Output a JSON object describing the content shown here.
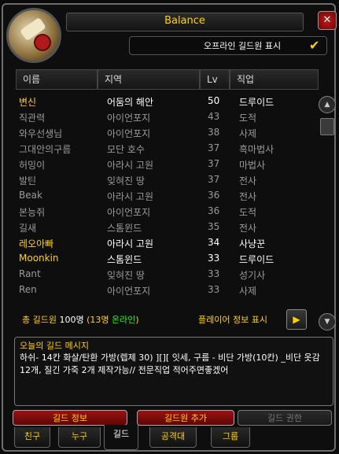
{
  "window": {
    "title": "Balance",
    "close_symbol": "✕"
  },
  "offline": {
    "label": "오프라인 길드원 표시",
    "checked": true,
    "check_symbol": "✔"
  },
  "columns": [
    "이름",
    "지역",
    "Lv",
    "직업"
  ],
  "members": [
    {
      "name": "변신",
      "zone": "어둠의 해안",
      "level": "50",
      "class": "드루이드",
      "online": true,
      "name_color": "#ffd100"
    },
    {
      "name": "직관력",
      "zone": "아이언포지",
      "level": "43",
      "class": "도적",
      "online": false,
      "name_color": "#9a9a9a"
    },
    {
      "name": "와우선생님",
      "zone": "아이언포지",
      "level": "38",
      "class": "사제",
      "online": false,
      "name_color": "#9a9a9a"
    },
    {
      "name": "그대안의구름",
      "zone": "모단 호수",
      "level": "37",
      "class": "흑마법사",
      "online": false,
      "name_color": "#9a9a9a"
    },
    {
      "name": "허밍이",
      "zone": "아라시 고원",
      "level": "37",
      "class": "마법사",
      "online": false,
      "name_color": "#9a9a9a"
    },
    {
      "name": "발틴",
      "zone": "잊혀진 땅",
      "level": "37",
      "class": "전사",
      "online": false,
      "name_color": "#9a9a9a"
    },
    {
      "name": "Beak",
      "zone": "아라시 고원",
      "level": "36",
      "class": "전사",
      "online": false,
      "name_color": "#9a9a9a"
    },
    {
      "name": "본능쥐",
      "zone": "아이언포지",
      "level": "36",
      "class": "도적",
      "online": false,
      "name_color": "#9a9a9a"
    },
    {
      "name": "길새",
      "zone": "스톰윈드",
      "level": "35",
      "class": "전사",
      "online": false,
      "name_color": "#9a9a9a"
    },
    {
      "name": "레오아빠",
      "zone": "아라시 고원",
      "level": "34",
      "class": "사냥꾼",
      "online": true,
      "name_color": "#ffd100"
    },
    {
      "name": "Moonkin",
      "zone": "스톰윈드",
      "level": "33",
      "class": "드루이드",
      "online": true,
      "name_color": "#ffd100"
    },
    {
      "name": "Rant",
      "zone": "잊혀진 땅",
      "level": "33",
      "class": "성기사",
      "online": false,
      "name_color": "#9a9a9a"
    },
    {
      "name": "Ren",
      "zone": "아이언포지",
      "level": "33",
      "class": "사제",
      "online": false,
      "name_color": "#9a9a9a"
    }
  ],
  "footer": {
    "total_prefix": "총 길드원 ",
    "total_count": "100명",
    "online_open": " (13명 ",
    "online_word": "온라인",
    "online_close": ")",
    "player_info": "플레이어 정보 표시",
    "play_symbol": "▶"
  },
  "motd": {
    "title": "오늘의 길드 메시지",
    "text": "하쉬- 14칸 화살/탄환 가방(렙제 30) ][][ 잇세, 구름 - 비단 가방(10칸) _비단 옷감 12개, 질긴 가죽 2개 제작가능// 전문직업 적어주면좋겠어"
  },
  "buttons": {
    "guild_info": "길드 정보",
    "add_member": "길드원 추가",
    "guild_rank": "길드 권한"
  },
  "tabs": [
    {
      "label": "친구",
      "active": false
    },
    {
      "label": "누구",
      "active": false
    },
    {
      "label": "길드",
      "active": true
    },
    {
      "label": "공격대",
      "active": false
    },
    {
      "label": "그룹",
      "active": false
    }
  ],
  "scroll": {
    "up_symbol": "▲",
    "down_symbol": "▼"
  },
  "colors": {
    "gold": "#ffd100",
    "offline_gray": "#9a9a9a",
    "online_white": "#ffffff",
    "online_green": "#1eff00",
    "button_red": "#9a1212"
  }
}
